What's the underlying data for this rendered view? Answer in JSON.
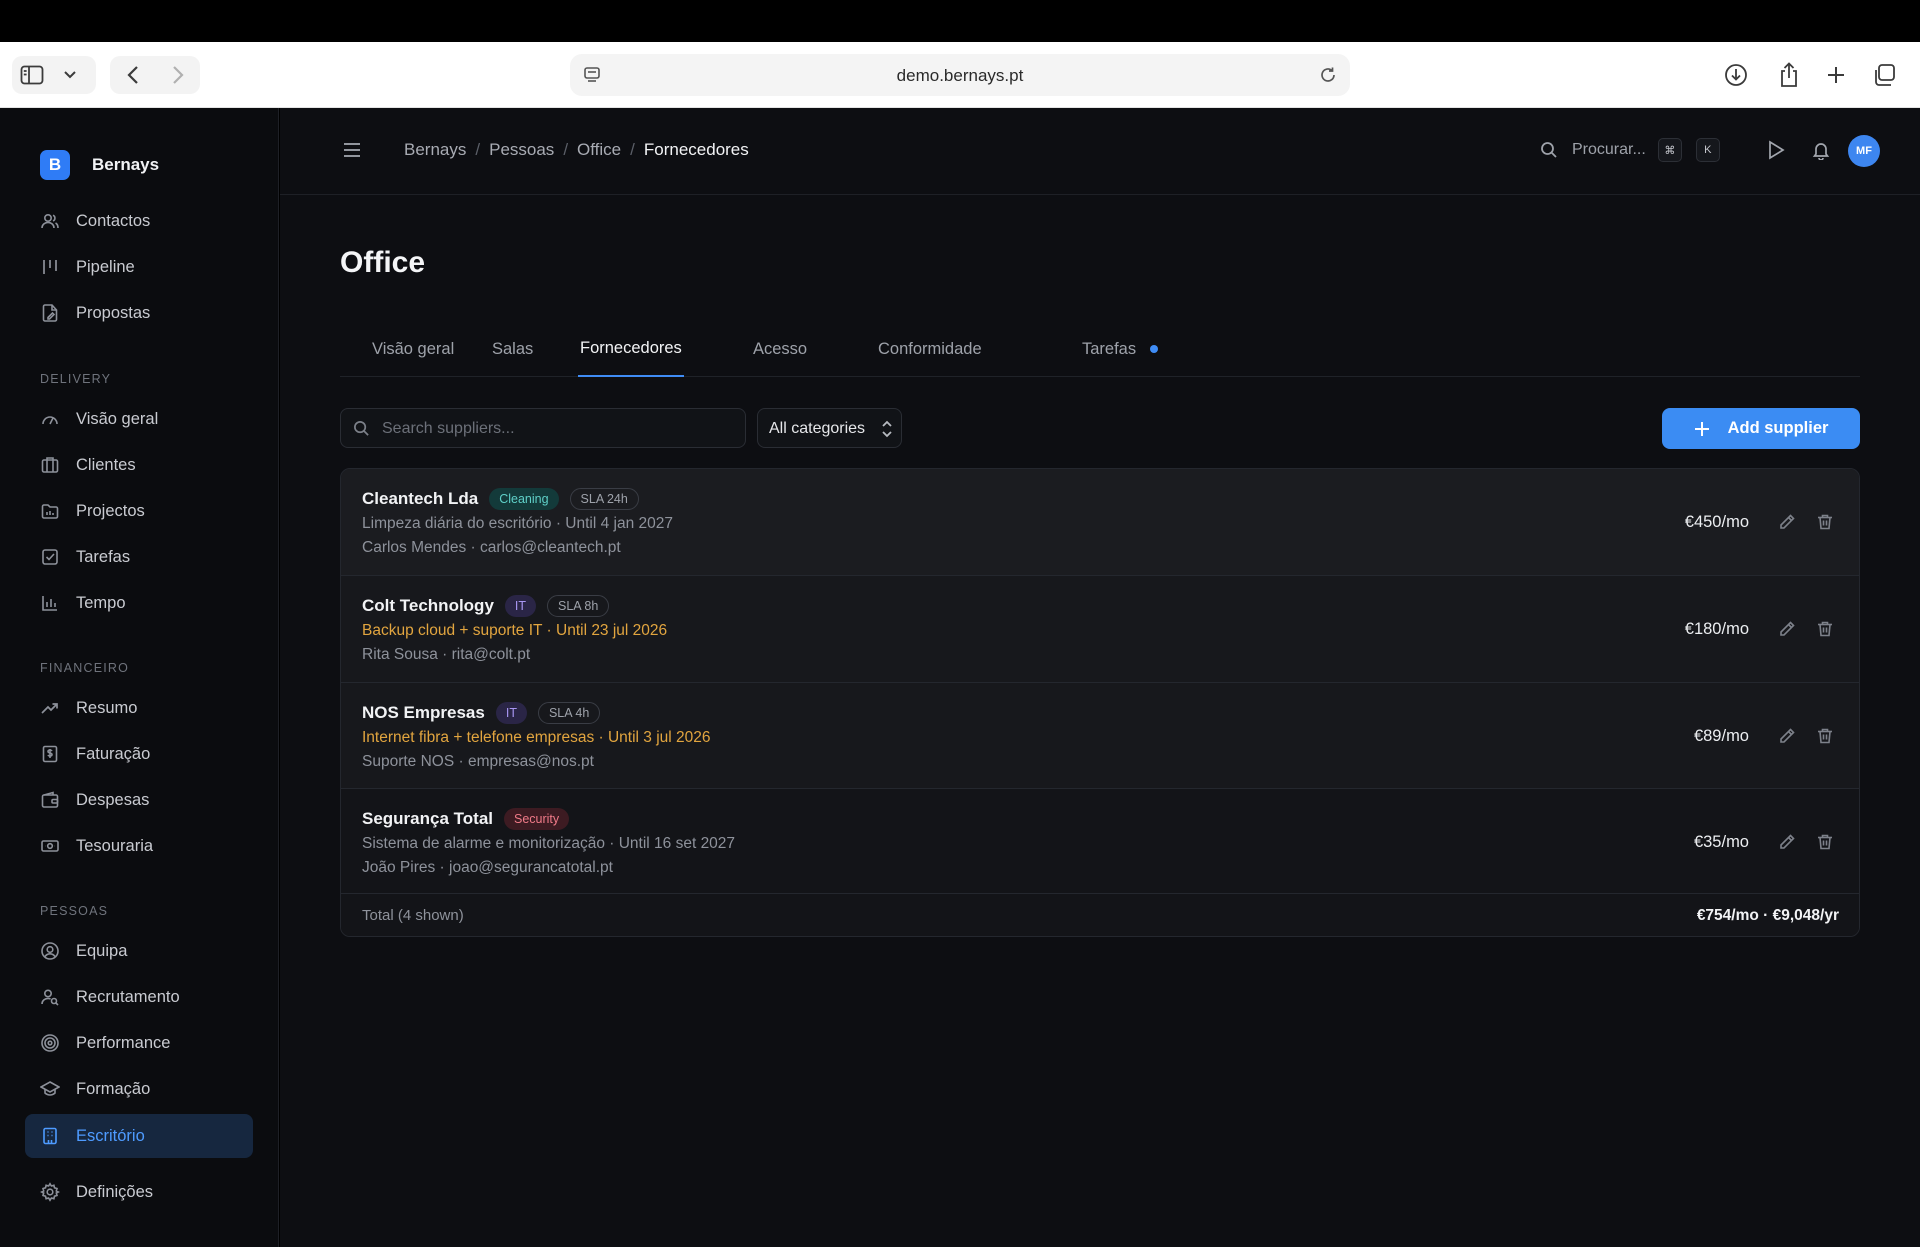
{
  "browser": {
    "url": "demo.bernays.pt"
  },
  "sidebar": {
    "brand": {
      "logo": "B",
      "name": "Bernays"
    },
    "top_items": [
      {
        "label": "Contactos",
        "icon": "users-icon"
      },
      {
        "label": "Pipeline",
        "icon": "pipeline-icon"
      },
      {
        "label": "Propostas",
        "icon": "document-edit-icon"
      }
    ],
    "sections": [
      {
        "title": "DELIVERY",
        "items": [
          {
            "label": "Visão geral",
            "icon": "gauge-icon"
          },
          {
            "label": "Clientes",
            "icon": "building-icon"
          },
          {
            "label": "Projectos",
            "icon": "folder-icon"
          },
          {
            "label": "Tarefas",
            "icon": "checkbox-icon"
          },
          {
            "label": "Tempo",
            "icon": "bar-chart-icon"
          }
        ]
      },
      {
        "title": "FINANCEIRO",
        "items": [
          {
            "label": "Resumo",
            "icon": "trend-up-icon"
          },
          {
            "label": "Faturação",
            "icon": "invoice-icon"
          },
          {
            "label": "Despesas",
            "icon": "wallet-icon"
          },
          {
            "label": "Tesouraria",
            "icon": "banknote-icon"
          }
        ]
      },
      {
        "title": "PESSOAS",
        "items": [
          {
            "label": "Equipa",
            "icon": "user-circle-icon"
          },
          {
            "label": "Recrutamento",
            "icon": "user-search-icon"
          },
          {
            "label": "Performance",
            "icon": "target-icon"
          },
          {
            "label": "Formação",
            "icon": "graduation-cap-icon"
          },
          {
            "label": "Escritório",
            "icon": "office-building-icon",
            "active": true
          }
        ]
      }
    ],
    "bottom_item": {
      "label": "Definições",
      "icon": "gear-icon"
    }
  },
  "header": {
    "breadcrumb": [
      "Bernays",
      "Pessoas",
      "Office",
      "Fornecedores"
    ],
    "search_label": "Procurar...",
    "shortcut_keys": [
      "⌘",
      "K"
    ]
  },
  "page": {
    "title": "Office",
    "tabs": [
      {
        "label": "Visão geral"
      },
      {
        "label": "Salas"
      },
      {
        "label": "Fornecedores",
        "active": true
      },
      {
        "label": "Acesso"
      },
      {
        "label": "Conformidade"
      },
      {
        "label": "Tarefas",
        "dot": true
      }
    ],
    "search_placeholder": "Search suppliers...",
    "category_select": "All categories",
    "add_button": "Add supplier",
    "suppliers": [
      {
        "name": "Cleantech Lda",
        "category": "Cleaning",
        "sla": "SLA 24h",
        "description": "Limpeza diária do escritório · Until 4 jan 2027",
        "contact": "Carlos Mendes · carlos@cleantech.pt",
        "price": "€450/mo"
      },
      {
        "name": "Colt Technology",
        "category": "IT",
        "sla": "SLA 8h",
        "description": "Backup cloud + suporte IT · Until 23 jul 2026",
        "contact": "Rita Sousa · rita@colt.pt",
        "price": "€180/mo"
      },
      {
        "name": "NOS Empresas",
        "category": "IT",
        "sla": "SLA 4h",
        "description": "Internet fibra + telefone empresas · Until 3 jul 2026",
        "contact": "Suporte NOS · empresas@nos.pt",
        "price": "€89/mo"
      },
      {
        "name": "Segurança Total",
        "category": "Security",
        "description": "Sistema de alarme e monitorização · Until 16 set 2027",
        "contact": "João Pires · joao@segurancatotal.pt",
        "price": "€35/mo"
      }
    ],
    "total_label": "Total (4 shown)",
    "total_value": "€754/mo · €9,048/yr"
  },
  "colors": {
    "accent": "#3b8cf3",
    "warning_text": "#e2a53f",
    "background": "#0d0e12",
    "sidebar": "#0b0c0f"
  }
}
